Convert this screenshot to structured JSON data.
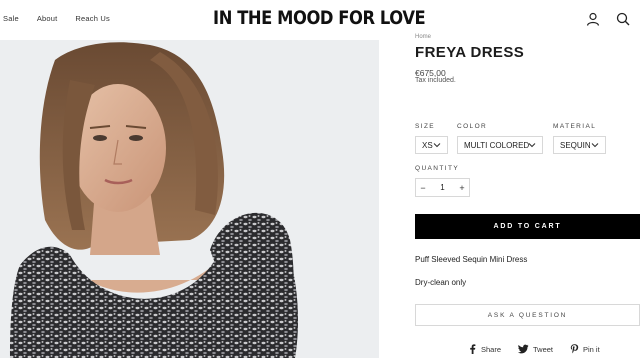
{
  "nav": {
    "items": [
      {
        "label": "Sale"
      },
      {
        "label": "About"
      },
      {
        "label": "Reach Us"
      }
    ]
  },
  "brand": {
    "logo": "IN THE MOOD FOR LOVE"
  },
  "header_icons": [
    "account-icon",
    "search-icon"
  ],
  "product": {
    "breadcrumb": "Home",
    "title": "FREYA DRESS",
    "price": "€675,00",
    "tax_note": "Tax included.",
    "options": {
      "size": {
        "label": "SIZE",
        "value": "XS"
      },
      "color": {
        "label": "COLOR",
        "value": "MULTI COLORED"
      },
      "material": {
        "label": "MATERIAL",
        "value": "SEQUIN"
      }
    },
    "quantity": {
      "label": "QUANTITY",
      "value": "1",
      "minus": "−",
      "plus": "+"
    },
    "add_to_cart": "ADD TO CART",
    "description": "Puff Sleeved Sequin Mini Dress",
    "care": "Dry-clean only",
    "ask_question": "ASK A QUESTION"
  },
  "share": {
    "facebook": "Share",
    "twitter": "Tweet",
    "pinterest": "Pin it"
  },
  "colors": {
    "button_bg": "#000000",
    "button_text": "#ffffff",
    "border": "#d8d8d8",
    "text": "#1c1c1c"
  }
}
